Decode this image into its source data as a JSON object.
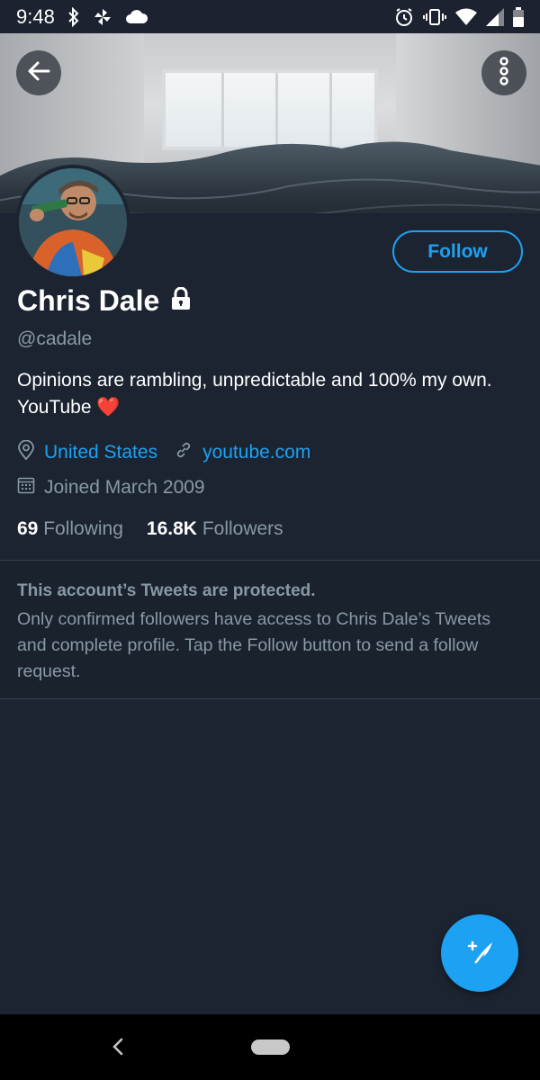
{
  "status_bar": {
    "time": "9:48"
  },
  "profile": {
    "display_name": "Chris Dale",
    "handle": "@cadale",
    "bio": "Opinions are rambling, unpredictable and 100% my own. YouTube",
    "bio_emoji": "❤️",
    "location": "United States",
    "website": "youtube.com",
    "joined": "Joined March 2009",
    "following_count": "69",
    "following_label": "Following",
    "followers_count": "16.8K",
    "followers_label": "Followers"
  },
  "actions": {
    "follow_label": "Follow"
  },
  "protected": {
    "title": "This account’s Tweets are protected.",
    "body": "Only confirmed followers have access to Chris Dale’s Tweets and complete profile. Tap the Follow button to send a follow request."
  },
  "icons": {
    "back": "arrow-left-icon",
    "more": "more-vertical-icon",
    "lock": "lock-icon",
    "location": "location-pin-icon",
    "link": "link-icon",
    "calendar": "calendar-icon",
    "compose": "compose-tweet-icon"
  },
  "colors": {
    "background": "#1c2431",
    "accent": "#1da1f2",
    "muted_text": "#8899a6",
    "heart": "#e0245e"
  }
}
